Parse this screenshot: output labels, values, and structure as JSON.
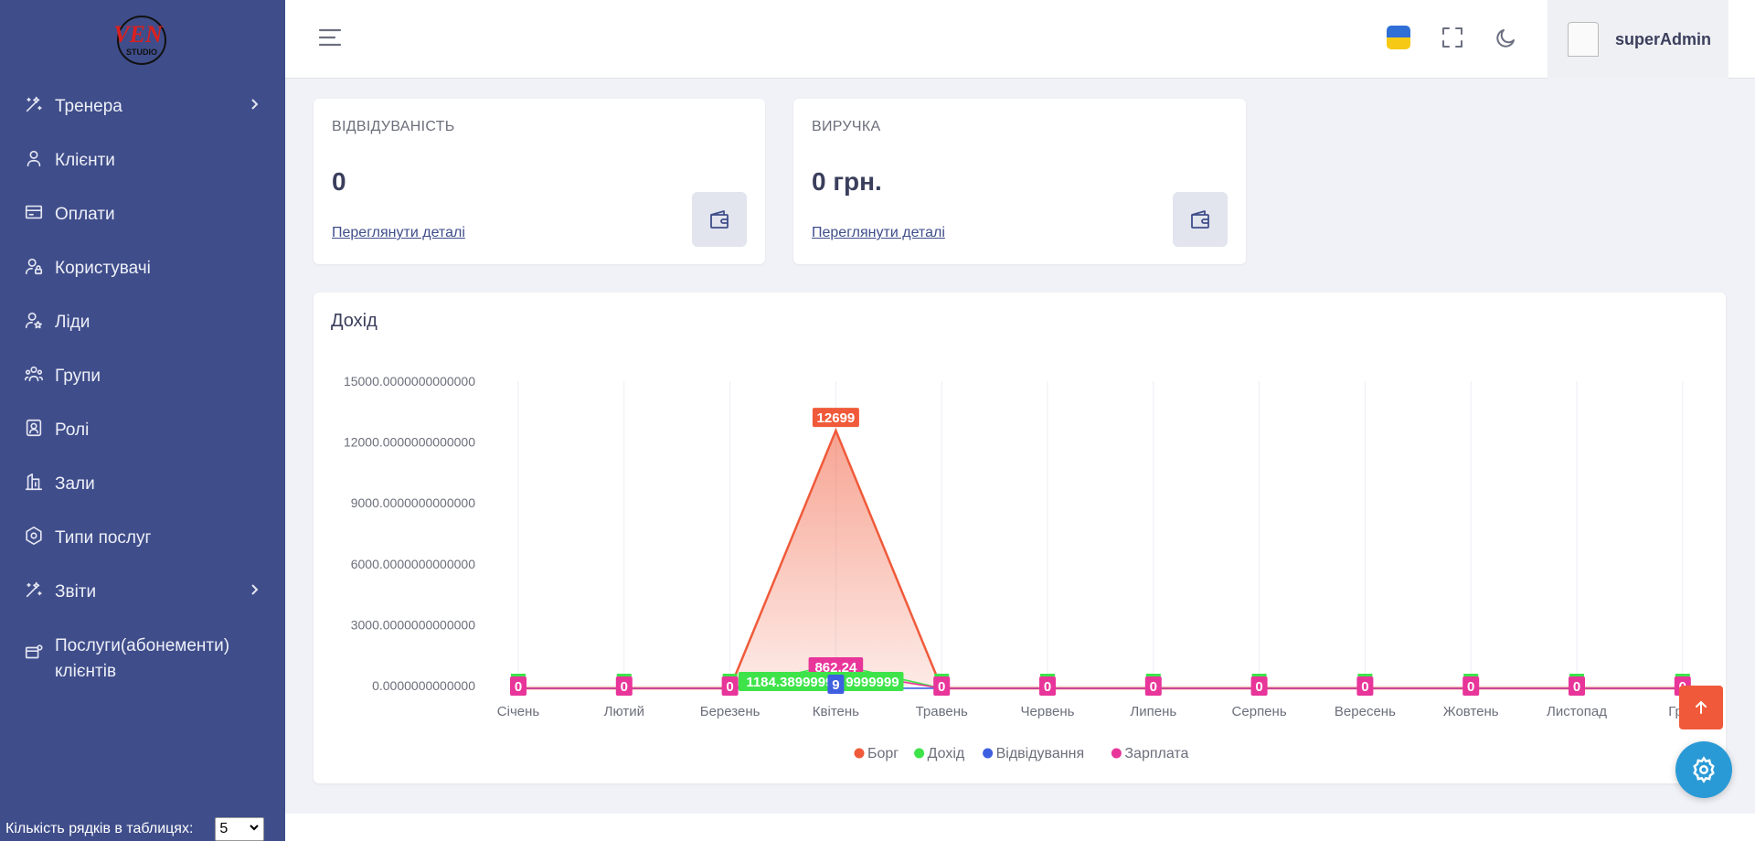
{
  "sidebar": {
    "logo_text": "VEN STUDIO",
    "items": [
      {
        "label": "Тренера",
        "icon": "wand-icon",
        "has_submenu": true
      },
      {
        "label": "Клієнти",
        "icon": "user-icon",
        "has_submenu": false
      },
      {
        "label": "Оплати",
        "icon": "card-icon",
        "has_submenu": false
      },
      {
        "label": "Користувачі",
        "icon": "user-lock-icon",
        "has_submenu": false
      },
      {
        "label": "Ліди",
        "icon": "user-star-icon",
        "has_submenu": false
      },
      {
        "label": "Групи",
        "icon": "group-icon",
        "has_submenu": false
      },
      {
        "label": "Ролі",
        "icon": "badge-icon",
        "has_submenu": false
      },
      {
        "label": "Зали",
        "icon": "building-icon",
        "has_submenu": false
      },
      {
        "label": "Типи послуг",
        "icon": "hexagon-icon",
        "has_submenu": false
      },
      {
        "label": "Звіти",
        "icon": "wand-icon",
        "has_submenu": true
      },
      {
        "label": "Послуги(абонементи) клієнтів",
        "icon": "card-settings-icon",
        "has_submenu": false
      }
    ],
    "rows_label": "Кількість рядків в таблицях:",
    "rows_value": "5"
  },
  "topbar": {
    "username": "superAdmin",
    "flag_colors": [
      "#2f6fd6",
      "#f6c915"
    ]
  },
  "cards": [
    {
      "title": "ВІДВІДУВАНІСТЬ",
      "value": "0",
      "link": "Переглянути деталі",
      "icon": "wallet-icon"
    },
    {
      "title": "ВИРУЧКА",
      "value": "0 грн.",
      "link": "Переглянути деталі",
      "icon": "wallet-icon"
    }
  ],
  "chart_data": {
    "type": "area",
    "title": "Дохід",
    "categories": [
      "Січень",
      "Лютий",
      "Березень",
      "Квітень",
      "Травень",
      "Червень",
      "Липень",
      "Серпень",
      "Вересень",
      "Жовтень",
      "Листопад",
      "Груд"
    ],
    "ylim": [
      0,
      15000
    ],
    "yticks": [
      "0.0000000000000",
      "3000.0000000000000",
      "6000.0000000000000",
      "9000.0000000000000",
      "12000.0000000000000",
      "15000.0000000000000"
    ],
    "grid": true,
    "legend_position": "bottom",
    "series": [
      {
        "name": "Борг",
        "color": "#f05a3a",
        "values": [
          0,
          0,
          0,
          12699,
          0,
          0,
          0,
          0,
          0,
          0,
          0,
          0
        ]
      },
      {
        "name": "Дохід",
        "color": "#3ee34a",
        "values": [
          0,
          0,
          0,
          1184.3899999999,
          0,
          0,
          0,
          0,
          0,
          0,
          0,
          0
        ]
      },
      {
        "name": "Відвідування",
        "color": "#3d5fe0",
        "values": [
          0,
          0,
          0,
          9,
          0,
          0,
          0,
          0,
          0,
          0,
          0,
          0
        ]
      },
      {
        "name": "Зарплата",
        "color": "#e8359a",
        "values": [
          0,
          0,
          0,
          862.24,
          0,
          0,
          0,
          0,
          0,
          0,
          0,
          0
        ]
      }
    ],
    "data_labels": {
      "Борг": [
        "0",
        "0",
        "0",
        "12699",
        "0",
        "0",
        "0",
        "0",
        "0",
        "0",
        "0",
        "0"
      ],
      "Дохід_april": "1184.3899999999",
      "Відвідування_april": "9",
      "Зарплата_april": "862.24"
    }
  },
  "colors": {
    "sidebar_bg": "#3f4d8a",
    "accent": "#3f4d8a",
    "scroll_top_bg": "#f05a3a",
    "settings_fab_bg": "#2a9ad6"
  }
}
